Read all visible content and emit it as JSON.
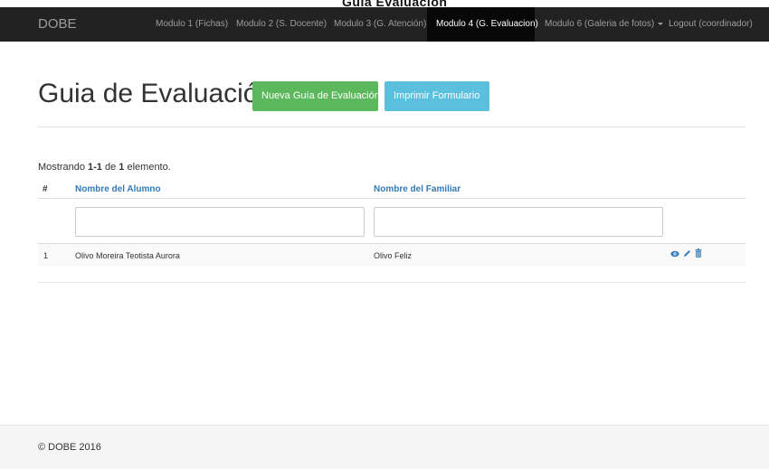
{
  "top_clip_text": "Guia Evaluacion",
  "nav": {
    "brand": "DOBE",
    "items": [
      {
        "label": "Modulo 1 (Fichas)"
      },
      {
        "label": "Modulo 2 (S. Docente)"
      },
      {
        "label": "Modulo 3 (G. Atención)"
      },
      {
        "label": "Modulo 4 (G. Evaluacion)"
      },
      {
        "label": "Modulo 6 (Galeria de fotos)"
      },
      {
        "label": "Logout (coordinador)"
      }
    ],
    "active_index": 3
  },
  "page": {
    "title": "Guia de Evaluación",
    "new_button": "Nueva Guía de Evaluación",
    "print_button": "Imprimir Formulario"
  },
  "summary": {
    "prefix": "Mostrando ",
    "range": "1-1",
    "middle": " de ",
    "total": "1",
    "suffix": " elemento."
  },
  "table": {
    "headers": [
      "#",
      "Nombre del Alumno",
      "Nombre del Familiar"
    ],
    "filters": {
      "alumno": "",
      "familiar": ""
    },
    "rows": [
      {
        "num": "1",
        "alumno": "Olivo Moreira Teotista Aurora",
        "familiar": "Olivo Feliz"
      }
    ],
    "action_icons": [
      "eye-icon",
      "pencil-icon",
      "trash-icon"
    ]
  },
  "footer": {
    "text": "© DOBE 2016"
  },
  "colors": {
    "navbar": "#222222",
    "success": "#5cb85c",
    "info": "#5bc0de",
    "link": "#337ab7"
  }
}
